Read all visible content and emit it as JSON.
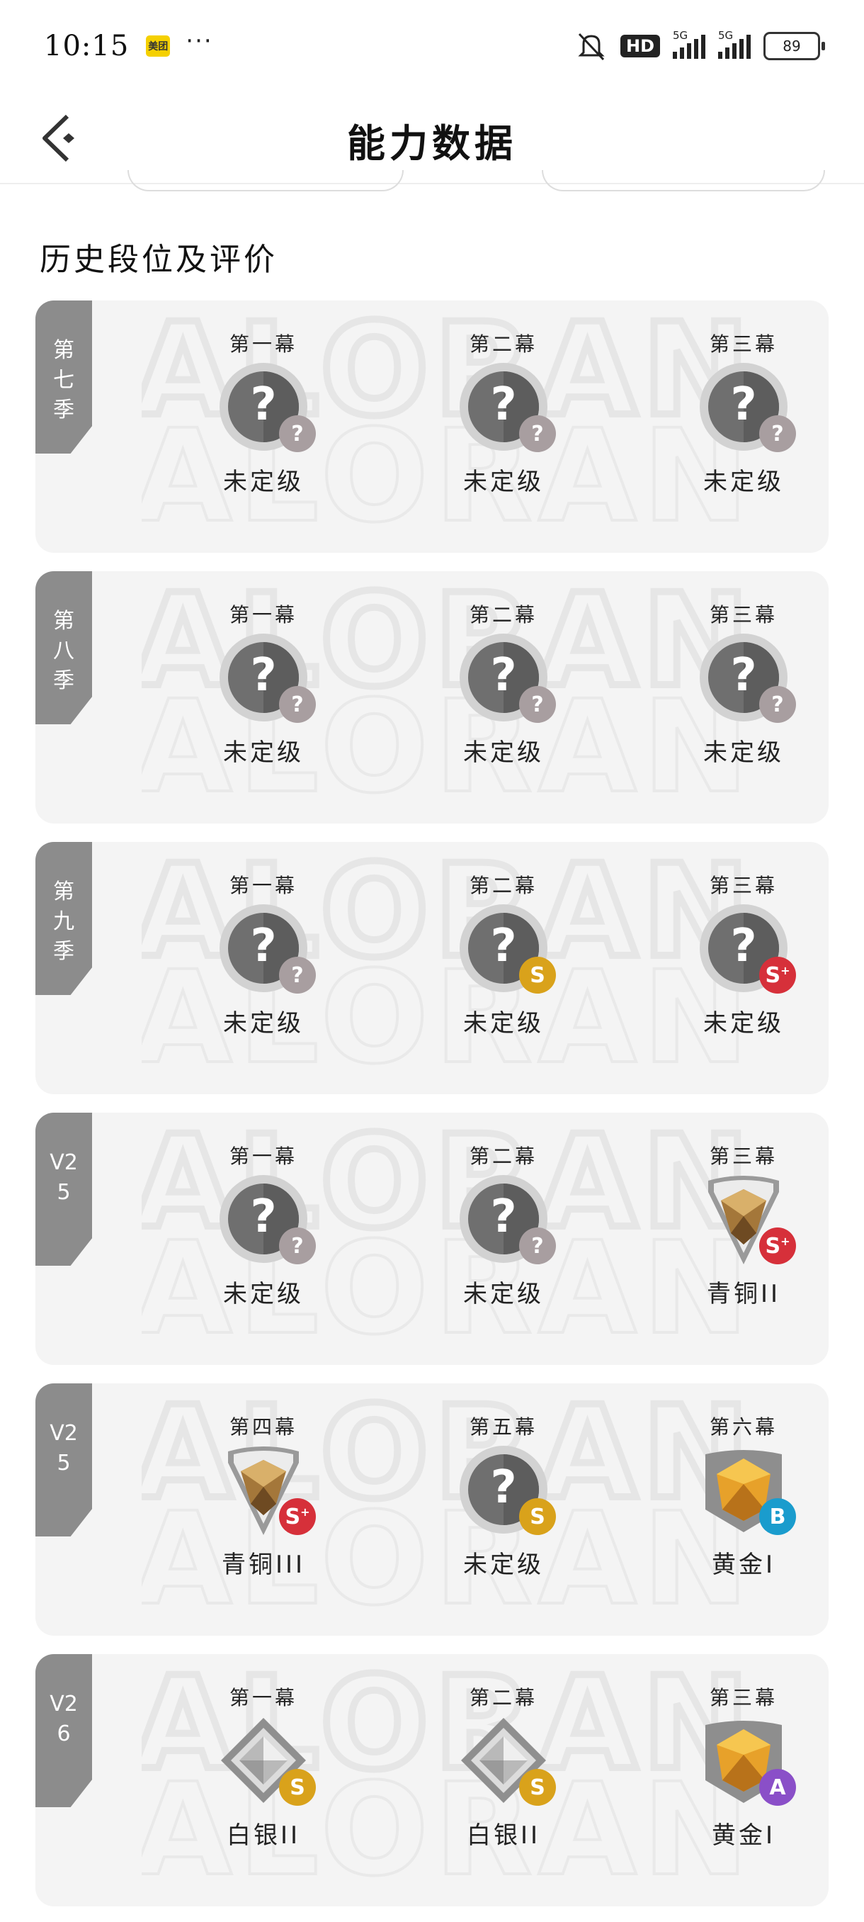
{
  "status": {
    "time": "10:15",
    "app_badge": "美团",
    "dots": "···",
    "hd": "HD",
    "network1": "5G",
    "network2": "5G",
    "battery": "89"
  },
  "nav": {
    "title": "能力数据"
  },
  "section": {
    "title": "历史段位及评价"
  },
  "watermark": "VALORANT",
  "seasons": [
    {
      "label": "第七季",
      "acts": [
        {
          "name": "第一幕",
          "rank": "未定级",
          "badge": "unranked",
          "grade": "?"
        },
        {
          "name": "第二幕",
          "rank": "未定级",
          "badge": "unranked",
          "grade": "?"
        },
        {
          "name": "第三幕",
          "rank": "未定级",
          "badge": "unranked",
          "grade": "?"
        }
      ]
    },
    {
      "label": "第八季",
      "acts": [
        {
          "name": "第一幕",
          "rank": "未定级",
          "badge": "unranked",
          "grade": "?"
        },
        {
          "name": "第二幕",
          "rank": "未定级",
          "badge": "unranked",
          "grade": "?"
        },
        {
          "name": "第三幕",
          "rank": "未定级",
          "badge": "unranked",
          "grade": "?"
        }
      ]
    },
    {
      "label": "第九季",
      "acts": [
        {
          "name": "第一幕",
          "rank": "未定级",
          "badge": "unranked",
          "grade": "?"
        },
        {
          "name": "第二幕",
          "rank": "未定级",
          "badge": "unranked",
          "grade": "S"
        },
        {
          "name": "第三幕",
          "rank": "未定级",
          "badge": "unranked",
          "grade": "S+"
        }
      ]
    },
    {
      "label": "V25",
      "acts": [
        {
          "name": "第一幕",
          "rank": "未定级",
          "badge": "unranked",
          "grade": "?"
        },
        {
          "name": "第二幕",
          "rank": "未定级",
          "badge": "unranked",
          "grade": "?"
        },
        {
          "name": "第三幕",
          "rank": "青铜II",
          "badge": "bronze",
          "grade": "S+"
        }
      ]
    },
    {
      "label": "V25",
      "acts": [
        {
          "name": "第四幕",
          "rank": "青铜III",
          "badge": "bronze",
          "grade": "S+"
        },
        {
          "name": "第五幕",
          "rank": "未定级",
          "badge": "unranked",
          "grade": "S"
        },
        {
          "name": "第六幕",
          "rank": "黄金I",
          "badge": "gold",
          "grade": "B"
        }
      ]
    },
    {
      "label": "V26",
      "acts": [
        {
          "name": "第一幕",
          "rank": "白银II",
          "badge": "silver",
          "grade": "S"
        },
        {
          "name": "第二幕",
          "rank": "白银II",
          "badge": "silver",
          "grade": "S"
        },
        {
          "name": "第三幕",
          "rank": "黄金I",
          "badge": "gold",
          "grade": "A"
        }
      ]
    }
  ],
  "colors": {
    "grade_unknown": "#a89ea0",
    "grade_S": "#d9a21b",
    "grade_S_plus": "#d6303a",
    "grade_A": "#8a4fc8",
    "grade_B": "#1a9ccd",
    "ribbon": "#8c8c8c",
    "card": "#f4f4f4"
  }
}
